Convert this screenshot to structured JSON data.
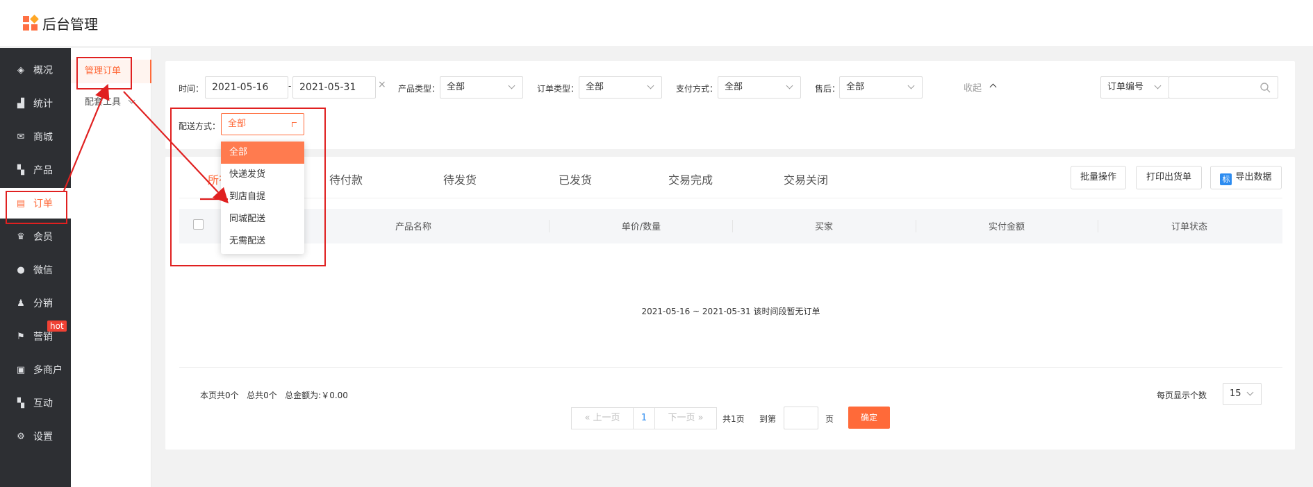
{
  "app": {
    "title": "后台管理"
  },
  "nav": {
    "items": [
      {
        "label": "概况",
        "icon": "layers-icon"
      },
      {
        "label": "统计",
        "icon": "chart-icon"
      },
      {
        "label": "商城",
        "icon": "mail-icon"
      },
      {
        "label": "产品",
        "icon": "grid-icon"
      },
      {
        "label": "订单",
        "icon": "order-icon",
        "active": true
      },
      {
        "label": "会员",
        "icon": "crown-icon"
      },
      {
        "label": "微信",
        "icon": "chat-icon"
      },
      {
        "label": "分销",
        "icon": "users-icon"
      },
      {
        "label": "营销",
        "icon": "flag-icon"
      },
      {
        "label": "多商户",
        "icon": "store-icon"
      },
      {
        "label": "互动",
        "icon": "interact-icon"
      },
      {
        "label": "设置",
        "icon": "gear-icon"
      }
    ],
    "hot_badge": "hot"
  },
  "subnav": {
    "items": [
      {
        "label": "管理订单",
        "active": true
      },
      {
        "label": "配套工具"
      }
    ]
  },
  "filters": {
    "time_label": "时间：",
    "date_start": "2021-05-16",
    "date_sep": "-",
    "date_end": "2021-05-31",
    "clear": "×",
    "product_type_label": "产品类型：",
    "product_type_value": "全部",
    "order_type_label": "订单类型：",
    "order_type_value": "全部",
    "pay_label": "支付方式：",
    "pay_value": "全部",
    "aftersale_label": "售后：",
    "aftersale_value": "全部",
    "collapse": "收起",
    "order_no_select": "订单编号",
    "delivery_label": "配送方式：",
    "delivery_value": "全部"
  },
  "delivery_dropdown": {
    "options": [
      "全部",
      "快递发货",
      "到店自提",
      "同城配送",
      "无需配送"
    ],
    "selected": "全部"
  },
  "tabs": [
    "所有",
    "待付款",
    "待发货",
    "已发货",
    "交易完成",
    "交易关闭"
  ],
  "actions": {
    "batch": "批量操作",
    "print": "打印出货单",
    "export_icon": "标",
    "export": "导出数据"
  },
  "table": {
    "headers": [
      "产品名称",
      "单价/数量",
      "买家",
      "实付金额",
      "订单状态"
    ],
    "empty": "2021-05-16 ~ 2021-05-31 该时间段暂无订单"
  },
  "summary": "本页共0个   总共0个   总金额为:￥0.00",
  "pagination": {
    "prev": "上一页",
    "current": "1",
    "next": "下一页",
    "total": "共1页",
    "goto_label": "到第",
    "page_unit": "页",
    "confirm": "确定",
    "per_page_label": "每页显示个数",
    "per_page": "15"
  },
  "colors": {
    "accent": "#ff6a39",
    "sidebar": "#2d2f33",
    "annotation": "#e02020"
  }
}
